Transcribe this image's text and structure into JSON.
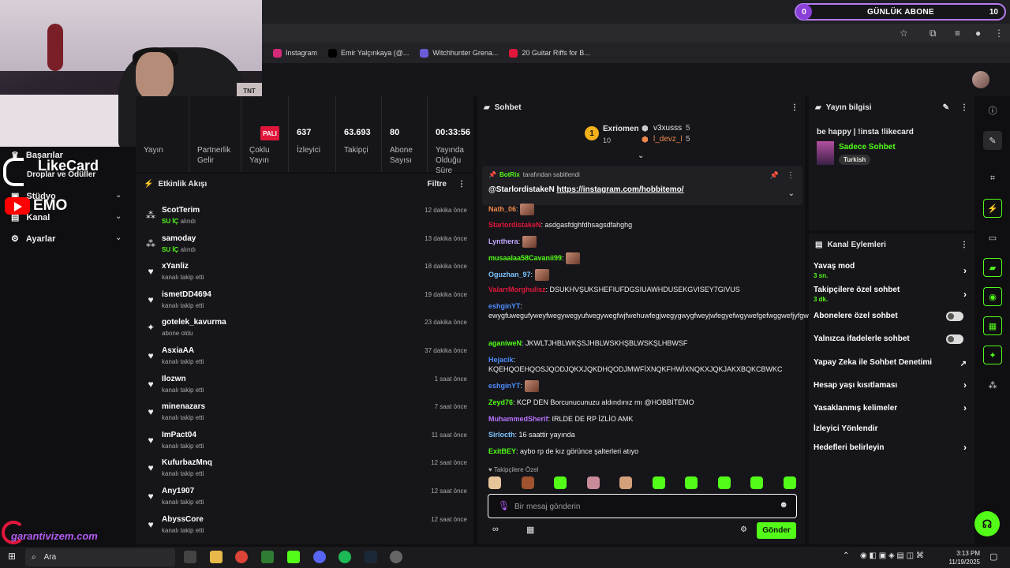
{
  "sub_goal": {
    "current": "0",
    "label": "GÜNLÜK ABONE",
    "target": "10"
  },
  "bookmarks": [
    {
      "label": "Instagram",
      "color": "#d6297a"
    },
    {
      "label": "Emir Yalçınkaya (@...",
      "color": "#000000"
    },
    {
      "label": "Witchhunter Grena...",
      "color": "#6b5bd6"
    },
    {
      "label": "20 Guitar Riffs for B...",
      "color": "#e0173b"
    }
  ],
  "left_nav": {
    "items": [
      {
        "label": "Başarılar"
      },
      {
        "label": "Droplar ve Ödüller"
      },
      {
        "label": "Stüdyo"
      },
      {
        "label": "Kanal"
      },
      {
        "label": "Ayarlar"
      }
    ],
    "likecard": "LikeCard",
    "yt": "EMO",
    "garanti": "garantivizem.com"
  },
  "stats": {
    "live_badge": "PALI",
    "items": [
      {
        "value": "",
        "label": "Yayın"
      },
      {
        "value": "",
        "label": "Partnerlik Gelir"
      },
      {
        "value": "",
        "label": "Çoklu Yayın"
      },
      {
        "value": "637",
        "label": "İzleyici"
      },
      {
        "value": "63.693",
        "label": "Takipçi"
      },
      {
        "value": "80",
        "label": "Abone Sayısı"
      },
      {
        "value": "00:33:56",
        "label": "Yayında Olduğu Süre"
      }
    ]
  },
  "activity": {
    "title": "Etkinlik Akışı",
    "filter": "Filtre",
    "items": [
      {
        "name": "ScotTerim",
        "pre": "SU İÇ",
        "desc": "alındı",
        "time": "12 dakika önce",
        "icon": "reward"
      },
      {
        "name": "samoday",
        "pre": "SU İÇ",
        "desc": "alındı",
        "time": "13 dakika önce",
        "icon": "reward"
      },
      {
        "name": "xYanliz",
        "pre": "",
        "desc": "kanalı takip etti",
        "time": "18 dakika önce",
        "icon": "heart"
      },
      {
        "name": "ismetDD4694",
        "pre": "",
        "desc": "kanalı takip etti",
        "time": "19 dakika önce",
        "icon": "heart"
      },
      {
        "name": "gotelek_kavurma",
        "pre": "",
        "desc": "abone oldu",
        "time": "23 dakika önce",
        "icon": "star"
      },
      {
        "name": "AsxiaAA",
        "pre": "",
        "desc": "kanalı takip etti",
        "time": "37 dakika önce",
        "icon": "heart"
      },
      {
        "name": "Ilozwn",
        "pre": "",
        "desc": "kanalı takip etti",
        "time": "1 saat önce",
        "icon": "heart"
      },
      {
        "name": "minenazars",
        "pre": "",
        "desc": "kanalı takip etti",
        "time": "7 saat önce",
        "icon": "heart"
      },
      {
        "name": "ImPact04",
        "pre": "",
        "desc": "kanalı takip etti",
        "time": "11 saat önce",
        "icon": "heart"
      },
      {
        "name": "KufurbazMnq",
        "pre": "",
        "desc": "kanalı takip etti",
        "time": "12 saat önce",
        "icon": "heart"
      },
      {
        "name": "Any1907",
        "pre": "",
        "desc": "kanalı takip etti",
        "time": "12 saat önce",
        "icon": "heart"
      },
      {
        "name": "AbyssCore",
        "pre": "",
        "desc": "kanalı takip etti",
        "time": "12 saat önce",
        "icon": "heart"
      }
    ]
  },
  "chat": {
    "title": "Sohbet",
    "top_gifters": [
      {
        "name": "Exriomen",
        "count": "10",
        "color": "#f2b11a"
      },
      {
        "name": "v3xusss",
        "count": "5",
        "color": "#cccccc"
      },
      {
        "name": "l_devz_l",
        "count": "5",
        "color": "#f2b11a"
      }
    ],
    "pinned": {
      "by": "BotRix",
      "by_suffix": "tarafından sabitlendi",
      "mention": "@StarlordistakeN",
      "link": "https://instagram.com/hobbitemo/"
    },
    "messages": [
      {
        "user": "Nath_06",
        "color": "#f08a4b",
        "text": "",
        "emote": true
      },
      {
        "user": "StarlordistakeN",
        "color": "#e0173b",
        "text": "asdgasfdghfdhsagsdfahghg",
        "emote": false
      },
      {
        "user": "Lynthera",
        "color": "#c3a6ff",
        "text": "",
        "emote": true
      },
      {
        "user": "musaalaa58Cavanii99",
        "color": "#53fc18",
        "text": "",
        "emote": true
      },
      {
        "user": "Oguzhan_97",
        "color": "#7cc4ff",
        "text": "",
        "emote": true
      },
      {
        "user": "ValarrMorghulisz",
        "color": "#e0173b",
        "text": "DSUKHVŞUKSHEFIUFDGSIUAWHDUSEKGVISEY7GIVUS",
        "emote": false
      },
      {
        "user": "eshginYT",
        "color": "#4e8cff",
        "text": "ewygfuwegufyweyfwegywegyufwegywegfwjfwehuwfegjwegygwygfweyjwfegyefwgywefgefwggwefjyfgweyjuywfeukjwfehkjwefhjfehwjhkwfe",
        "emote": false
      },
      {
        "user": "aganiweN",
        "color": "#53fc18",
        "text": "JKWLTJHBLWKŞSJHBLWSKHŞBLWSKŞLHBWSF",
        "emote": false
      },
      {
        "user": "Hejacik",
        "color": "#4e8cff",
        "text": "KQEHQOEHQOSJQODJQKXJQKDHQODJMWFİXNQKFHWİXNQKXJQKJAKXBQKCBWKC",
        "emote": false
      },
      {
        "user": "eshginYT",
        "color": "#4e8cff",
        "text": "",
        "emote": true
      },
      {
        "user": "Zeyd76",
        "color": "#53fc18",
        "text": "KCP DEN Borcunucunuzu aldındınız mı @HOBBİTEMO",
        "emote": false
      },
      {
        "user": "MuhammedSherif",
        "color": "#b673ff",
        "text": "IRLDE DE RP İZLİO AMK",
        "emote": false
      },
      {
        "user": "Sirlocth",
        "color": "#7cc4ff",
        "text": "16 saattir yayında",
        "emote": false
      },
      {
        "user": "ExitBEY",
        "color": "#53fc18",
        "text": "aybo rp de kız görünce şalterleri atıyo",
        "emote": false
      }
    ],
    "followers_only": "Takipçilere Özel",
    "input_placeholder": "Bir mesaj gönderin",
    "send": "Gönder"
  },
  "info": {
    "title": "Yayın bilgisi",
    "stream_title": "be happy | !insta !likecard",
    "category": "Sadece Sohbet",
    "language": "Turkish"
  },
  "actions": {
    "title": "Kanal Eylemleri",
    "items": [
      {
        "label": "Yavaş mod",
        "sub": "3 sn.",
        "ctrl": "chev"
      },
      {
        "label": "Takipçilere özel sohbet",
        "sub": "3 dk.",
        "ctrl": "chev"
      },
      {
        "label": "Abonelere özel sohbet",
        "sub": "",
        "ctrl": "toggle"
      },
      {
        "label": "Yalnızca ifadelerle sohbet",
        "sub": "",
        "ctrl": "toggle"
      },
      {
        "label": "Yapay Zeka ile Sohbet Denetimi",
        "sub": "",
        "ctrl": "ext"
      },
      {
        "label": "Hesap yaşı kısıtlaması",
        "sub": "",
        "ctrl": "chev"
      },
      {
        "label": "Yasaklanmış kelimeler",
        "sub": "",
        "ctrl": "chev"
      },
      {
        "label": "İzleyici Yönlendir",
        "sub": "",
        "ctrl": "none"
      },
      {
        "label": "Hedefleri belirleyin",
        "sub": "",
        "ctrl": "chev"
      }
    ]
  },
  "taskbar": {
    "search": "Ara",
    "time": "3:13 PM",
    "date": "11/19/2025"
  }
}
